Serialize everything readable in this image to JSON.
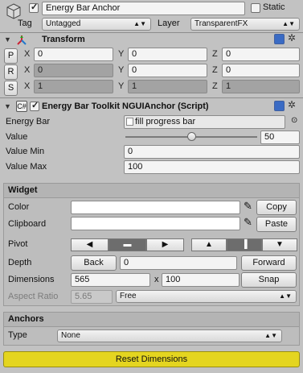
{
  "object": {
    "active": true,
    "name": "Energy Bar Anchor",
    "static_label": "Static",
    "tag_label": "Tag",
    "tag_value": "Untagged",
    "layer_label": "Layer",
    "layer_value": "TransparentFX"
  },
  "transform": {
    "title": "Transform",
    "position": {
      "btn": "P",
      "x": "0",
      "y": "0",
      "z": "0"
    },
    "rotation": {
      "btn": "R",
      "x": "0",
      "y": "0",
      "z": "0"
    },
    "scale": {
      "btn": "S",
      "x": "1",
      "y": "1",
      "z": "1"
    },
    "axes": [
      "X",
      "Y",
      "Z"
    ]
  },
  "script": {
    "title": "Energy Bar Toolkit NGUIAnchor (Script)",
    "energy_bar_label": "Energy Bar",
    "energy_bar_value": "fill progress bar",
    "value_label": "Value",
    "value": "50",
    "slider_level": 0.5,
    "value_min_label": "Value Min",
    "value_min": "0",
    "value_max_label": "Value Max",
    "value_max": "100"
  },
  "widget": {
    "title": "Widget",
    "color_label": "Color",
    "copy_label": "Copy",
    "clipboard_label": "Clipboard",
    "paste_label": "Paste",
    "pivot_label": "Pivot",
    "depth_label": "Depth",
    "back_label": "Back",
    "depth_value": "0",
    "forward_label": "Forward",
    "dimensions_label": "Dimensions",
    "width": "565",
    "x_sep": "x",
    "height": "100",
    "snap_label": "Snap",
    "aspect_label": "Aspect Ratio",
    "aspect_value": "5.65",
    "aspect_mode": "Free"
  },
  "anchors": {
    "title": "Anchors",
    "type_label": "Type",
    "type_value": "None"
  },
  "footer": {
    "reset_label": "Reset Dimensions"
  },
  "colors": {
    "reset_button": "#e4d520",
    "slider_track": "#7a7a7a"
  }
}
